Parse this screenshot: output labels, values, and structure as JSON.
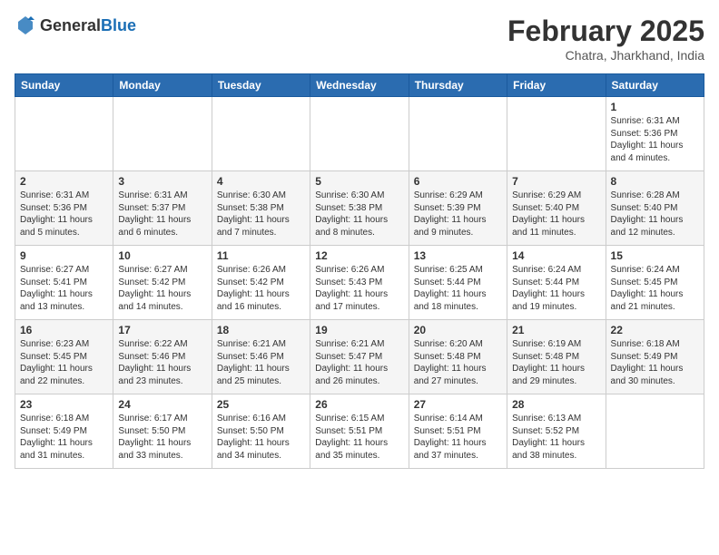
{
  "logo": {
    "text_general": "General",
    "text_blue": "Blue"
  },
  "header": {
    "title": "February 2025",
    "subtitle": "Chatra, Jharkhand, India"
  },
  "weekdays": [
    "Sunday",
    "Monday",
    "Tuesday",
    "Wednesday",
    "Thursday",
    "Friday",
    "Saturday"
  ],
  "weeks": [
    [
      {
        "day": "",
        "info": ""
      },
      {
        "day": "",
        "info": ""
      },
      {
        "day": "",
        "info": ""
      },
      {
        "day": "",
        "info": ""
      },
      {
        "day": "",
        "info": ""
      },
      {
        "day": "",
        "info": ""
      },
      {
        "day": "1",
        "info": "Sunrise: 6:31 AM\nSunset: 5:36 PM\nDaylight: 11 hours and 4 minutes."
      }
    ],
    [
      {
        "day": "2",
        "info": "Sunrise: 6:31 AM\nSunset: 5:36 PM\nDaylight: 11 hours and 5 minutes."
      },
      {
        "day": "3",
        "info": "Sunrise: 6:31 AM\nSunset: 5:37 PM\nDaylight: 11 hours and 6 minutes."
      },
      {
        "day": "4",
        "info": "Sunrise: 6:30 AM\nSunset: 5:38 PM\nDaylight: 11 hours and 7 minutes."
      },
      {
        "day": "5",
        "info": "Sunrise: 6:30 AM\nSunset: 5:38 PM\nDaylight: 11 hours and 8 minutes."
      },
      {
        "day": "6",
        "info": "Sunrise: 6:29 AM\nSunset: 5:39 PM\nDaylight: 11 hours and 9 minutes."
      },
      {
        "day": "7",
        "info": "Sunrise: 6:29 AM\nSunset: 5:40 PM\nDaylight: 11 hours and 11 minutes."
      },
      {
        "day": "8",
        "info": "Sunrise: 6:28 AM\nSunset: 5:40 PM\nDaylight: 11 hours and 12 minutes."
      }
    ],
    [
      {
        "day": "9",
        "info": "Sunrise: 6:27 AM\nSunset: 5:41 PM\nDaylight: 11 hours and 13 minutes."
      },
      {
        "day": "10",
        "info": "Sunrise: 6:27 AM\nSunset: 5:42 PM\nDaylight: 11 hours and 14 minutes."
      },
      {
        "day": "11",
        "info": "Sunrise: 6:26 AM\nSunset: 5:42 PM\nDaylight: 11 hours and 16 minutes."
      },
      {
        "day": "12",
        "info": "Sunrise: 6:26 AM\nSunset: 5:43 PM\nDaylight: 11 hours and 17 minutes."
      },
      {
        "day": "13",
        "info": "Sunrise: 6:25 AM\nSunset: 5:44 PM\nDaylight: 11 hours and 18 minutes."
      },
      {
        "day": "14",
        "info": "Sunrise: 6:24 AM\nSunset: 5:44 PM\nDaylight: 11 hours and 19 minutes."
      },
      {
        "day": "15",
        "info": "Sunrise: 6:24 AM\nSunset: 5:45 PM\nDaylight: 11 hours and 21 minutes."
      }
    ],
    [
      {
        "day": "16",
        "info": "Sunrise: 6:23 AM\nSunset: 5:45 PM\nDaylight: 11 hours and 22 minutes."
      },
      {
        "day": "17",
        "info": "Sunrise: 6:22 AM\nSunset: 5:46 PM\nDaylight: 11 hours and 23 minutes."
      },
      {
        "day": "18",
        "info": "Sunrise: 6:21 AM\nSunset: 5:46 PM\nDaylight: 11 hours and 25 minutes."
      },
      {
        "day": "19",
        "info": "Sunrise: 6:21 AM\nSunset: 5:47 PM\nDaylight: 11 hours and 26 minutes."
      },
      {
        "day": "20",
        "info": "Sunrise: 6:20 AM\nSunset: 5:48 PM\nDaylight: 11 hours and 27 minutes."
      },
      {
        "day": "21",
        "info": "Sunrise: 6:19 AM\nSunset: 5:48 PM\nDaylight: 11 hours and 29 minutes."
      },
      {
        "day": "22",
        "info": "Sunrise: 6:18 AM\nSunset: 5:49 PM\nDaylight: 11 hours and 30 minutes."
      }
    ],
    [
      {
        "day": "23",
        "info": "Sunrise: 6:18 AM\nSunset: 5:49 PM\nDaylight: 11 hours and 31 minutes."
      },
      {
        "day": "24",
        "info": "Sunrise: 6:17 AM\nSunset: 5:50 PM\nDaylight: 11 hours and 33 minutes."
      },
      {
        "day": "25",
        "info": "Sunrise: 6:16 AM\nSunset: 5:50 PM\nDaylight: 11 hours and 34 minutes."
      },
      {
        "day": "26",
        "info": "Sunrise: 6:15 AM\nSunset: 5:51 PM\nDaylight: 11 hours and 35 minutes."
      },
      {
        "day": "27",
        "info": "Sunrise: 6:14 AM\nSunset: 5:51 PM\nDaylight: 11 hours and 37 minutes."
      },
      {
        "day": "28",
        "info": "Sunrise: 6:13 AM\nSunset: 5:52 PM\nDaylight: 11 hours and 38 minutes."
      },
      {
        "day": "",
        "info": ""
      }
    ]
  ]
}
